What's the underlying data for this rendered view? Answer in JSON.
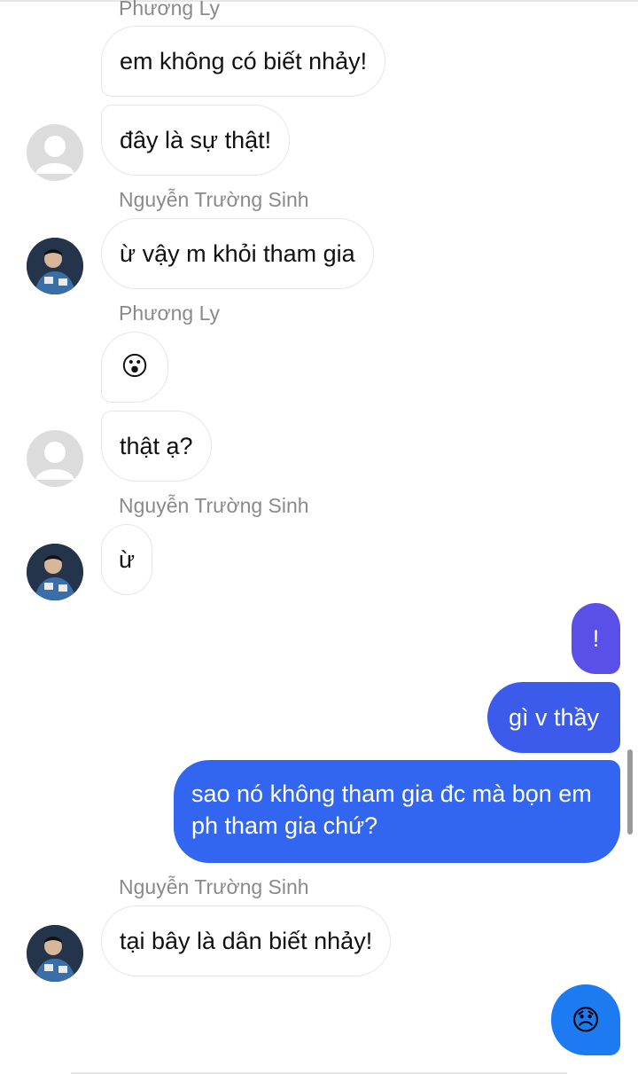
{
  "senders": {
    "phuong_ly": "Phương Ly",
    "nguyen_truong_sinh": "Nguyễn Trường Sinh"
  },
  "messages": {
    "m1": "em không có biết nhảy!",
    "m2": "đây là sự thật!",
    "m3": "ừ vậy m khỏi tham gia",
    "m4": "😮",
    "m5": "thật ạ?",
    "m6": "ừ",
    "m7": "!",
    "m8": "gì v thầy",
    "m9": "sao nó không tham gia đc mà bọn em ph tham gia chứ?",
    "m10": "tại bây là dân biết nhảy!",
    "m11": "😞"
  },
  "colors": {
    "my_bubble_1": "#5a4fe6",
    "my_bubble_2": "#3d5bea",
    "my_bubble_3": "#3266f0",
    "reaction": "#1d7bf2"
  },
  "icons": {
    "default_avatar": "default-avatar-icon",
    "photo_avatar": "profile-photo"
  }
}
